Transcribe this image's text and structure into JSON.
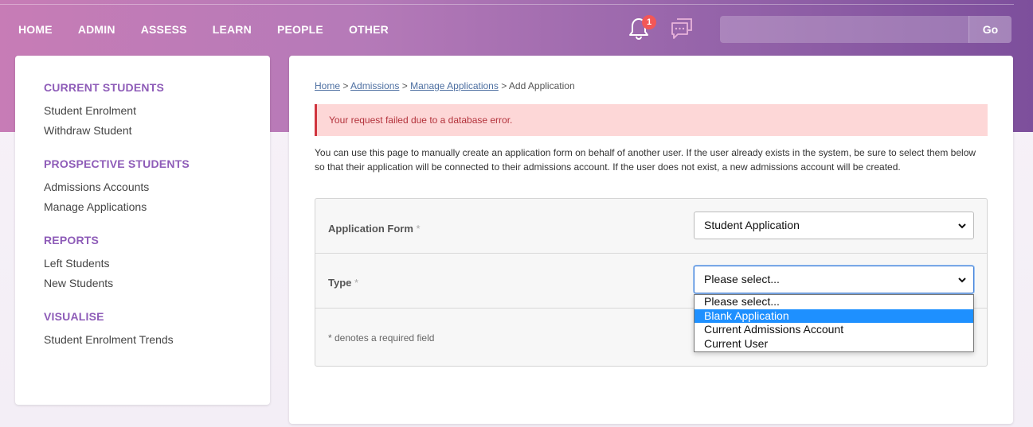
{
  "nav": {
    "items": [
      "HOME",
      "ADMIN",
      "ASSESS",
      "LEARN",
      "PEOPLE",
      "OTHER"
    ],
    "notification_count": "1",
    "search_placeholder": "",
    "go_label": "Go"
  },
  "sidebar": {
    "sections": [
      {
        "heading": "CURRENT STUDENTS",
        "items": [
          "Student Enrolment",
          "Withdraw Student"
        ]
      },
      {
        "heading": "PROSPECTIVE STUDENTS",
        "items": [
          "Admissions Accounts",
          "Manage Applications"
        ]
      },
      {
        "heading": "REPORTS",
        "items": [
          "Left Students",
          "New Students"
        ]
      },
      {
        "heading": "VISUALISE",
        "items": [
          "Student Enrolment Trends"
        ]
      }
    ]
  },
  "breadcrumb": {
    "links": [
      "Home",
      "Admissions",
      "Manage Applications"
    ],
    "separator": ">",
    "current": "Add Application"
  },
  "alert": {
    "message": "Your request failed due to a database error."
  },
  "description": "You can use this page to manually create an application form on behalf of another user. If the user already exists in the system, be sure to select them below so that their application will be connected to their admissions account. If the user does not exist, a new admissions account will be created.",
  "form": {
    "application_form_label": "Application Form",
    "application_form_value": "Student Application",
    "type_label": "Type",
    "type_value": "Please select...",
    "required_star": "*",
    "required_note": "* denotes a required field",
    "type_options": [
      "Please select...",
      "Blank Application",
      "Current Admissions Account",
      "Current User"
    ],
    "highlighted_option": "Blank Application"
  },
  "colors": {
    "accent": "#8e5cb8",
    "alert_bg": "#fdd7d7",
    "alert_border": "#d0343e",
    "option_highlight": "#1e90ff"
  }
}
